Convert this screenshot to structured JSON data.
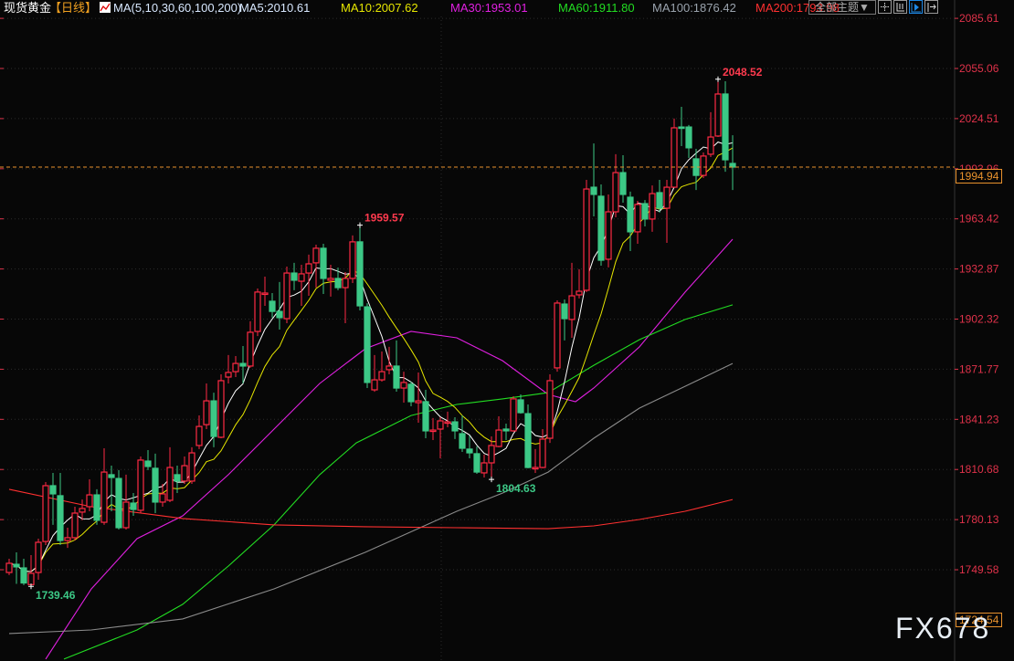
{
  "header": {
    "instrument": "现货黄金",
    "period": "【日线】",
    "ma_params": "MA(5,10,30,60,100,200)",
    "ma5": "MA5:2010.61",
    "ma10": "MA10:2007.62",
    "ma30": "MA30:1953.01",
    "ma60": "MA60:1911.80",
    "ma100": "MA100:1876.42",
    "ma200": "MA200:1793.98",
    "theme_button": "全部主题▼",
    "tools": [
      "crosshair-icon",
      "range-icon",
      "play-icon",
      "move-right-icon"
    ]
  },
  "colors": {
    "up": "#ff2a44",
    "down": "#3cc886",
    "ma5": "#ffffff",
    "ma10": "#e6e600",
    "ma30": "#e020e0",
    "ma60": "#22dd22",
    "ma100": "#8a8a8a",
    "ma200": "#ff3030",
    "last": "#e8912c"
  },
  "watermark": "FX678",
  "last_price": "1994.94",
  "cursor_price": "1724.54",
  "chart_data": {
    "type": "candlestick",
    "title": "现货黄金 日线",
    "y_ticks": [
      "2085.61",
      "2055.06",
      "2024.51",
      "1993.96",
      "1963.42",
      "1932.87",
      "1902.32",
      "1871.77",
      "1841.23",
      "1810.68",
      "1780.13",
      "1749.58"
    ],
    "ylim": [
      1690,
      2092
    ],
    "grid": true,
    "annotations": [
      {
        "index": 97,
        "value": 2048.52,
        "label": "2048.52",
        "kind": "high"
      },
      {
        "index": 48,
        "value": 1959.57,
        "label": "1959.57",
        "kind": "high"
      },
      {
        "index": 66,
        "value": 1804.63,
        "label": "1804.63",
        "kind": "low"
      },
      {
        "index": 3,
        "value": 1739.46,
        "label": "1739.46",
        "kind": "low"
      }
    ],
    "ohlc": [
      [
        1747.9,
        1756.3,
        1746.3,
        1753.5
      ],
      [
        1752.9,
        1760.2,
        1741.0,
        1751.3
      ],
      [
        1750.7,
        1756.3,
        1740.2,
        1741.5
      ],
      [
        1740.5,
        1758.5,
        1739.46,
        1747.4
      ],
      [
        1747.9,
        1768.5,
        1743.5,
        1766.3
      ],
      [
        1766.8,
        1803.0,
        1764.6,
        1800.8
      ],
      [
        1800.8,
        1808.6,
        1776.9,
        1795.8
      ],
      [
        1794.7,
        1808.6,
        1764.6,
        1767.4
      ],
      [
        1767.4,
        1775.2,
        1762.9,
        1769.1
      ],
      [
        1769.1,
        1788.0,
        1767.4,
        1784.1
      ],
      [
        1784.7,
        1792.4,
        1779.7,
        1786.9
      ],
      [
        1788.0,
        1804.7,
        1785.2,
        1795.2
      ],
      [
        1795.2,
        1798.6,
        1776.9,
        1779.7
      ],
      [
        1778.5,
        1823.6,
        1776.9,
        1809.1
      ],
      [
        1807.5,
        1813.0,
        1785.2,
        1805.8
      ],
      [
        1805.2,
        1810.3,
        1774.1,
        1775.2
      ],
      [
        1775.2,
        1807.5,
        1774.1,
        1790.8
      ],
      [
        1790.2,
        1796.3,
        1782.4,
        1786.3
      ],
      [
        1785.8,
        1818.6,
        1784.1,
        1816.4
      ],
      [
        1815.8,
        1822.5,
        1810.3,
        1812.5
      ],
      [
        1811.4,
        1820.3,
        1784.1,
        1790.8
      ],
      [
        1790.8,
        1801.9,
        1788.0,
        1795.8
      ],
      [
        1791.9,
        1824.2,
        1790.8,
        1811.9
      ],
      [
        1807.5,
        1813.0,
        1796.3,
        1803.6
      ],
      [
        1803.6,
        1818.6,
        1801.9,
        1813.0
      ],
      [
        1803.6,
        1824.2,
        1801.9,
        1820.8
      ],
      [
        1825.3,
        1843.6,
        1823.1,
        1836.9
      ],
      [
        1838.0,
        1863.1,
        1835.3,
        1852.5
      ],
      [
        1852.5,
        1857.5,
        1824.2,
        1830.8
      ],
      [
        1830.3,
        1868.7,
        1829.7,
        1864.8
      ],
      [
        1867.0,
        1880.4,
        1863.1,
        1869.8
      ],
      [
        1870.3,
        1879.8,
        1867.0,
        1875.3
      ],
      [
        1875.3,
        1885.9,
        1863.1,
        1873.7
      ],
      [
        1873.7,
        1901.0,
        1872.6,
        1894.3
      ],
      [
        1894.8,
        1921.0,
        1892.0,
        1918.8
      ],
      [
        1917.6,
        1928.2,
        1910.4,
        1918.2
      ],
      [
        1913.2,
        1918.2,
        1903.2,
        1907.0
      ],
      [
        1907.0,
        1924.9,
        1895.9,
        1903.2
      ],
      [
        1902.6,
        1934.3,
        1899.8,
        1930.4
      ],
      [
        1930.4,
        1936.6,
        1919.9,
        1926.0
      ],
      [
        1925.4,
        1935.4,
        1910.4,
        1929.9
      ],
      [
        1930.4,
        1941.6,
        1916.5,
        1936.0
      ],
      [
        1936.6,
        1947.7,
        1921.5,
        1945.5
      ],
      [
        1945.5,
        1948.2,
        1917.6,
        1927.1
      ],
      [
        1926.0,
        1935.4,
        1916.0,
        1927.1
      ],
      [
        1927.1,
        1933.7,
        1919.9,
        1921.5
      ],
      [
        1921.5,
        1931.0,
        1899.8,
        1927.1
      ],
      [
        1927.1,
        1953.3,
        1924.3,
        1949.4
      ],
      [
        1949.4,
        1959.57,
        1907.6,
        1910.4
      ],
      [
        1909.8,
        1912.0,
        1860.3,
        1863.7
      ],
      [
        1859.2,
        1880.4,
        1858.0,
        1865.3
      ],
      [
        1865.3,
        1882.6,
        1864.2,
        1870.3
      ],
      [
        1871.5,
        1885.4,
        1868.7,
        1873.7
      ],
      [
        1873.7,
        1889.3,
        1858.1,
        1860.3
      ],
      [
        1860.3,
        1870.3,
        1851.4,
        1863.7
      ],
      [
        1862.6,
        1864.2,
        1849.2,
        1852.0
      ],
      [
        1851.4,
        1869.8,
        1839.2,
        1852.5
      ],
      [
        1852.0,
        1859.2,
        1829.7,
        1834.2
      ],
      [
        1834.2,
        1842.0,
        1828.6,
        1834.7
      ],
      [
        1835.3,
        1842.5,
        1817.5,
        1840.3
      ],
      [
        1839.2,
        1845.9,
        1836.4,
        1839.7
      ],
      [
        1839.7,
        1842.5,
        1829.2,
        1834.2
      ],
      [
        1832.5,
        1843.6,
        1821.4,
        1823.6
      ],
      [
        1823.1,
        1831.4,
        1817.5,
        1820.8
      ],
      [
        1820.3,
        1824.7,
        1808.0,
        1809.1
      ],
      [
        1808.6,
        1819.7,
        1805.8,
        1814.7
      ],
      [
        1814.7,
        1830.8,
        1804.63,
        1825.3
      ],
      [
        1824.7,
        1843.1,
        1824.2,
        1834.7
      ],
      [
        1835.3,
        1838.6,
        1828.6,
        1834.2
      ],
      [
        1834.2,
        1855.3,
        1833.6,
        1853.7
      ],
      [
        1853.1,
        1856.4,
        1844.7,
        1845.3
      ],
      [
        1844.7,
        1850.3,
        1811.4,
        1811.9
      ],
      [
        1811.4,
        1823.1,
        1808.6,
        1811.9
      ],
      [
        1811.9,
        1835.3,
        1811.4,
        1829.2
      ],
      [
        1829.7,
        1868.7,
        1826.9,
        1864.8
      ],
      [
        1872.6,
        1913.7,
        1870.3,
        1912.1
      ],
      [
        1911.5,
        1914.3,
        1889.3,
        1902.6
      ],
      [
        1902.1,
        1936.6,
        1890.9,
        1916.5
      ],
      [
        1917.1,
        1932.7,
        1914.9,
        1919.3
      ],
      [
        1919.9,
        1987.2,
        1918.8,
        1981.6
      ],
      [
        1982.7,
        2009.4,
        1964.9,
        1978.3
      ],
      [
        1977.2,
        1984.4,
        1934.9,
        1938.2
      ],
      [
        1938.8,
        1978.3,
        1933.8,
        1967.7
      ],
      [
        1967.7,
        2002.8,
        1964.4,
        1991.6
      ],
      [
        1991.6,
        2002.2,
        1973.3,
        1978.3
      ],
      [
        1976.6,
        1980.0,
        1943.8,
        1955.5
      ],
      [
        1955.5,
        1974.4,
        1948.2,
        1972.2
      ],
      [
        1972.7,
        1974.9,
        1958.8,
        1963.3
      ],
      [
        1963.3,
        1983.8,
        1955.5,
        1978.8
      ],
      [
        1979.4,
        1987.2,
        1967.2,
        1969.9
      ],
      [
        1969.9,
        1987.2,
        1948.8,
        1982.7
      ],
      [
        1982.7,
        2024.5,
        1982.7,
        2018.9
      ],
      [
        2019.4,
        2031.7,
        2007.8,
        2018.9
      ],
      [
        2019.4,
        2020.6,
        2000.5,
        2006.7
      ],
      [
        2000.0,
        2006.1,
        1981.0,
        1989.9
      ],
      [
        1989.9,
        2003.9,
        1988.3,
        2001.7
      ],
      [
        2002.8,
        2028.4,
        2001.1,
        2013.3
      ],
      [
        2013.9,
        2048.52,
        2013.3,
        2039.5
      ],
      [
        2039.5,
        2047.3,
        1992.1,
        1999.4
      ],
      [
        1997.2,
        2014.4,
        1981.0,
        1994.94
      ]
    ],
    "moving_averages": [
      {
        "name": "MA30",
        "points": [
          [
            5,
            1695.1
          ],
          [
            11.25,
            1737.9
          ],
          [
            17.5,
            1768.5
          ],
          [
            23.75,
            1782.4
          ],
          [
            30,
            1807.5
          ],
          [
            36.25,
            1835.3
          ],
          [
            42.5,
            1863.1
          ],
          [
            48.75,
            1884.3
          ],
          [
            55,
            1894.8
          ],
          [
            61.25,
            1890.9
          ],
          [
            67.5,
            1877.0
          ],
          [
            73.75,
            1856.4
          ],
          [
            77.5,
            1852.0
          ],
          [
            80,
            1860.3
          ],
          [
            86.25,
            1885.4
          ],
          [
            92.5,
            1918.8
          ],
          [
            99,
            1951.0
          ]
        ]
      },
      {
        "name": "MA60",
        "points": [
          [
            7.5,
            1695.1
          ],
          [
            17.5,
            1712.9
          ],
          [
            23.75,
            1728.5
          ],
          [
            30,
            1751.8
          ],
          [
            36.25,
            1776.9
          ],
          [
            42.5,
            1807.5
          ],
          [
            47.5,
            1826.9
          ],
          [
            55,
            1843.6
          ],
          [
            61.25,
            1850.3
          ],
          [
            67.5,
            1853.7
          ],
          [
            73.75,
            1857.5
          ],
          [
            80,
            1874.2
          ],
          [
            86.25,
            1889.8
          ],
          [
            92.5,
            1902.1
          ],
          [
            99,
            1911.0
          ]
        ]
      },
      {
        "name": "MA100",
        "points": [
          [
            0,
            1710.7
          ],
          [
            11.25,
            1712.9
          ],
          [
            23.75,
            1719.6
          ],
          [
            36.25,
            1737.9
          ],
          [
            48.75,
            1760.2
          ],
          [
            61.25,
            1785.2
          ],
          [
            67.5,
            1796.3
          ],
          [
            73.75,
            1809.1
          ],
          [
            80,
            1829.7
          ],
          [
            86.25,
            1848.1
          ],
          [
            92.5,
            1861.4
          ],
          [
            99,
            1875.3
          ]
        ]
      },
      {
        "name": "MA200",
        "points": [
          [
            0,
            1798.6
          ],
          [
            11.25,
            1788.0
          ],
          [
            23.75,
            1780.8
          ],
          [
            36.25,
            1776.9
          ],
          [
            48.75,
            1775.8
          ],
          [
            61.25,
            1775.2
          ],
          [
            73.75,
            1774.6
          ],
          [
            80,
            1776.3
          ],
          [
            86.25,
            1780.2
          ],
          [
            92.5,
            1785.2
          ],
          [
            99,
            1792.4
          ]
        ]
      }
    ]
  }
}
